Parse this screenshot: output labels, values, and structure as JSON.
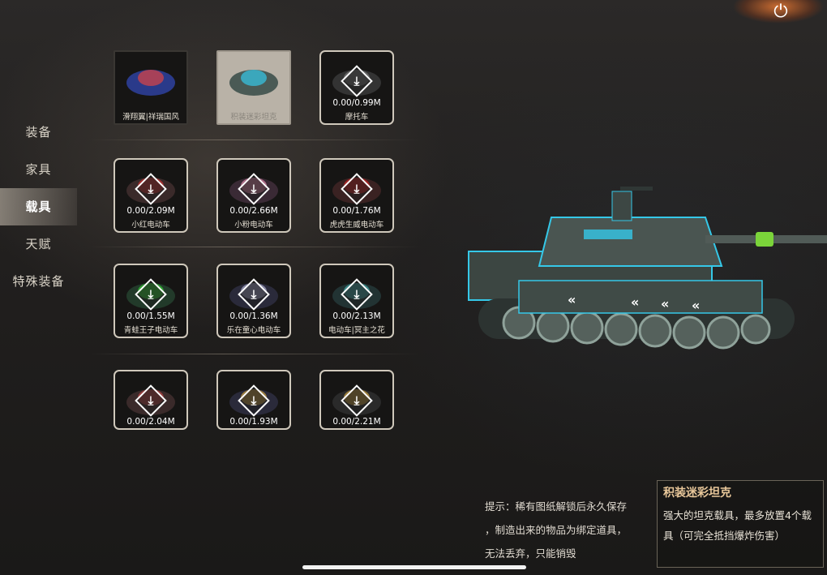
{
  "sidebar": {
    "items": [
      {
        "label": "装备"
      },
      {
        "label": "家具"
      },
      {
        "label": "载具",
        "active": true
      },
      {
        "label": "天赋"
      },
      {
        "label": "特殊装备"
      }
    ]
  },
  "grid": {
    "items": [
      {
        "label": "滑翔翼|祥瑞国风",
        "thumb": "glider",
        "progress": ""
      },
      {
        "label": "积装迷彩坦克",
        "thumb": "tank",
        "progress": "",
        "selected": true
      },
      {
        "label": "摩托车",
        "thumb": "motorcycle",
        "progress": "0.00/0.99M"
      },
      {
        "label": "小红电动车",
        "thumb": "scooter-red",
        "progress": "0.00/2.09M"
      },
      {
        "label": "小粉电动车",
        "thumb": "scooter-pink",
        "progress": "0.00/2.66M"
      },
      {
        "label": "虎虎生威电动车",
        "thumb": "scooter-tiger",
        "progress": "0.00/1.76M"
      },
      {
        "label": "青蛙王子电动车",
        "thumb": "scooter-frog",
        "progress": "0.00/1.55M"
      },
      {
        "label": "乐在童心电动车",
        "thumb": "scooter-kid",
        "progress": "0.00/1.36M"
      },
      {
        "label": "电动车|冥主之花",
        "thumb": "scooter-flower",
        "progress": "0.00/2.13M"
      },
      {
        "label": "",
        "thumb": "scooter-a",
        "progress": "0.00/2.04M"
      },
      {
        "label": "",
        "thumb": "scooter-b",
        "progress": "0.00/1.93M"
      },
      {
        "label": "",
        "thumb": "scooter-c",
        "progress": "0.00/2.21M"
      }
    ]
  },
  "hint": {
    "line1": "提示：稀有图纸解锁后永久保存",
    "line2": "，制造出来的物品为绑定道具，",
    "line3": "无法丢弃，只能销毁"
  },
  "info": {
    "title": "积装迷彩坦克",
    "desc_line1": "强大的坦克载具，最多放置4个载",
    "desc_line2": "具（可完全抵挡爆炸伤害）"
  },
  "icons": {
    "power": "power-icon",
    "download": "download-icon"
  },
  "colors": {
    "accent_title": "#e8c79a",
    "tank_neon": "#35c8e8",
    "barrel_ring": "#7bd43a"
  }
}
